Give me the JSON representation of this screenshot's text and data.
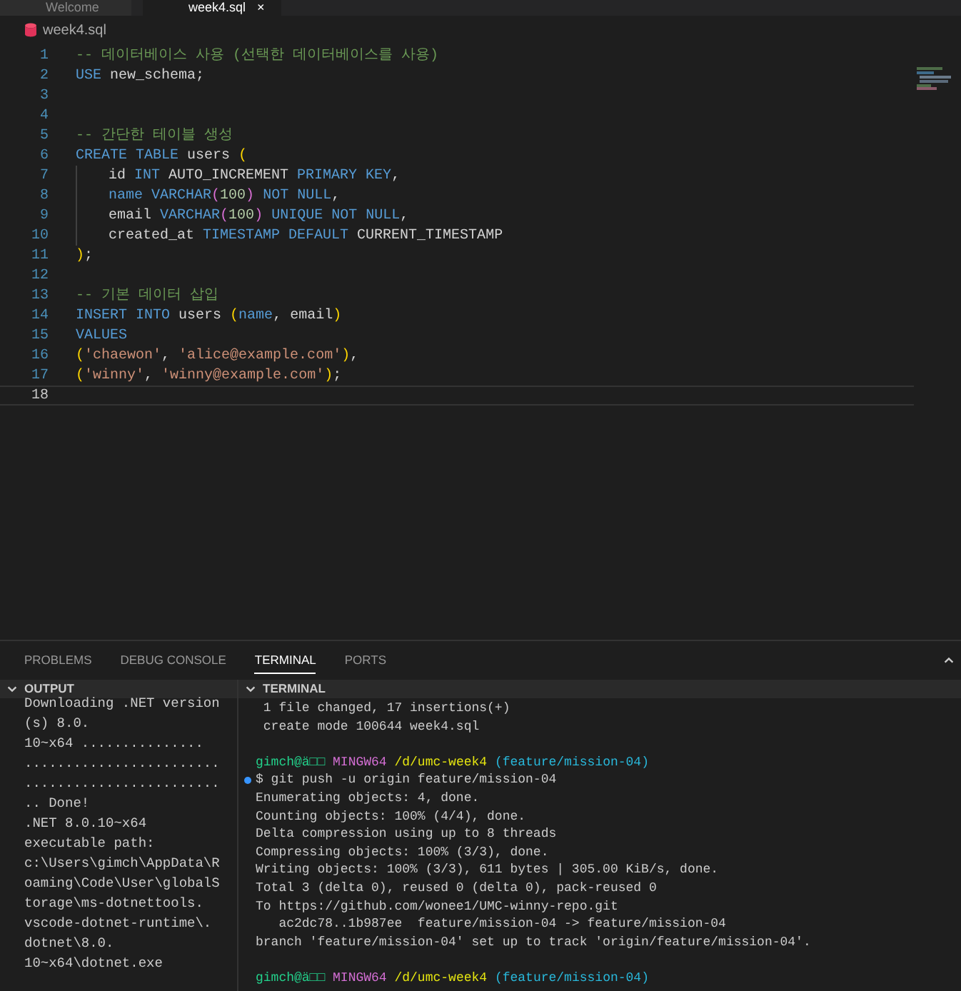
{
  "tabs": [
    {
      "label": "Welcome",
      "selected": false,
      "closable": false
    },
    {
      "label": "week4.sql",
      "selected": true,
      "closable": true
    }
  ],
  "tab_close": "×",
  "breadcrumb": "week4.sql",
  "editor": {
    "lines": [
      {
        "number": "1",
        "active": false,
        "tokens": [
          {
            "kind": "comment",
            "text": "-- 데이터베이스 사용 (선택한 데이터베이스를 사용)"
          }
        ]
      },
      {
        "number": "2",
        "active": false,
        "tokens": [
          {
            "kind": "keyword",
            "text": "USE"
          },
          {
            "kind": "plain",
            "text": " new_schema;"
          }
        ]
      },
      {
        "number": "3",
        "active": false
      },
      {
        "number": "4",
        "active": false
      },
      {
        "number": "5",
        "active": false,
        "tokens": [
          {
            "kind": "comment",
            "text": "-- 간단한 테이블 생성"
          }
        ]
      },
      {
        "number": "6",
        "active": false,
        "tokens": [
          {
            "kind": "keyword",
            "text": "CREATE TABLE"
          },
          {
            "kind": "plain",
            "text": " users "
          },
          {
            "kind": "paren",
            "text": "("
          }
        ]
      },
      {
        "number": "7",
        "active": false,
        "indent": true,
        "tokens": [
          {
            "kind": "plain",
            "text": "id "
          },
          {
            "kind": "keyword",
            "text": "INT"
          },
          {
            "kind": "plain",
            "text": " AUTO_INCREMENT "
          },
          {
            "kind": "keyword",
            "text": "PRIMARY KEY"
          },
          {
            "kind": "plain",
            "text": ","
          }
        ]
      },
      {
        "number": "8",
        "active": false,
        "indent": true,
        "tokens": [
          {
            "kind": "keyword",
            "text": "name VARCHAR"
          },
          {
            "kind": "paren2",
            "text": "("
          },
          {
            "kind": "number",
            "text": "100"
          },
          {
            "kind": "paren2",
            "text": ")"
          },
          {
            "kind": "keyword",
            "text": " NOT NULL"
          },
          {
            "kind": "plain",
            "text": ","
          }
        ]
      },
      {
        "number": "9",
        "active": false,
        "indent": true,
        "tokens": [
          {
            "kind": "plain",
            "text": "email "
          },
          {
            "kind": "keyword",
            "text": "VARCHAR"
          },
          {
            "kind": "paren2",
            "text": "("
          },
          {
            "kind": "number",
            "text": "100"
          },
          {
            "kind": "paren2",
            "text": ")"
          },
          {
            "kind": "keyword",
            "text": " UNIQUE NOT NULL"
          },
          {
            "kind": "plain",
            "text": ","
          }
        ]
      },
      {
        "number": "10",
        "active": false,
        "indent": true,
        "tokens": [
          {
            "kind": "plain",
            "text": "created_at "
          },
          {
            "kind": "keyword",
            "text": "TIMESTAMP DEFAULT"
          },
          {
            "kind": "plain",
            "text": " CURRENT_TIMESTAMP"
          }
        ]
      },
      {
        "number": "11",
        "active": false,
        "tokens": [
          {
            "kind": "paren",
            "text": ")"
          },
          {
            "kind": "plain",
            "text": ";"
          }
        ]
      },
      {
        "number": "12",
        "active": false
      },
      {
        "number": "13",
        "active": false,
        "tokens": [
          {
            "kind": "comment",
            "text": "-- 기본 데이터 삽입"
          }
        ]
      },
      {
        "number": "14",
        "active": false,
        "tokens": [
          {
            "kind": "keyword",
            "text": "INSERT INTO"
          },
          {
            "kind": "plain",
            "text": " users "
          },
          {
            "kind": "paren",
            "text": "("
          },
          {
            "kind": "keyword",
            "text": "name"
          },
          {
            "kind": "plain",
            "text": ", email"
          },
          {
            "kind": "paren",
            "text": ")"
          }
        ]
      },
      {
        "number": "15",
        "active": false,
        "tokens": [
          {
            "kind": "keyword",
            "text": "VALUES"
          }
        ]
      },
      {
        "number": "16",
        "active": false,
        "tokens": [
          {
            "kind": "paren",
            "text": "("
          },
          {
            "kind": "string",
            "text": "'chaewon'"
          },
          {
            "kind": "plain",
            "text": ", "
          },
          {
            "kind": "string",
            "text": "'alice@example.com'"
          },
          {
            "kind": "paren",
            "text": ")"
          },
          {
            "kind": "plain",
            "text": ","
          }
        ]
      },
      {
        "number": "17",
        "active": false,
        "tokens": [
          {
            "kind": "paren",
            "text": "("
          },
          {
            "kind": "string",
            "text": "'winny'"
          },
          {
            "kind": "plain",
            "text": ", "
          },
          {
            "kind": "string",
            "text": "'winny@example.com'"
          },
          {
            "kind": "paren",
            "text": ")"
          },
          {
            "kind": "plain",
            "text": ";"
          }
        ]
      },
      {
        "number": "18",
        "active": true
      }
    ]
  },
  "panel_tabs": [
    {
      "label": "PROBLEMS",
      "selected": false
    },
    {
      "label": "DEBUG CONSOLE",
      "selected": false
    },
    {
      "label": "TERMINAL",
      "selected": true
    },
    {
      "label": "PORTS",
      "selected": false
    }
  ],
  "output": {
    "title": "OUTPUT",
    "lines": [
      "Downloading .NET version",
      "(s) 8.0.",
      "10~x64 ...............",
      "........................",
      "........................",
      ".. Done!",
      ".NET 8.0.10~x64",
      "executable path:",
      "c:\\Users\\gimch\\AppData\\R",
      "oaming\\Code\\User\\globalS",
      "torage\\ms-dotnettools.",
      "vscode-dotnet-runtime\\.",
      "dotnet\\8.0.",
      "10~x64\\dotnet.exe"
    ]
  },
  "terminal": {
    "title": "TERMINAL",
    "lines": [
      {
        "kind": "text",
        "text": " 1 file changed, 17 insertions(+)"
      },
      {
        "kind": "text",
        "text": " create mode 100644 week4.sql"
      },
      {
        "kind": "blank"
      },
      {
        "kind": "prompt",
        "user": "gimch@ä□□",
        "host": "MINGW64",
        "path": "/d/umc-week4",
        "branch": "(feature/mission-04)"
      },
      {
        "kind": "command",
        "text": "$ git push -u origin feature/mission-04"
      },
      {
        "kind": "text",
        "text": "Enumerating objects: 4, done."
      },
      {
        "kind": "text",
        "text": "Counting objects: 100% (4/4), done."
      },
      {
        "kind": "text",
        "text": "Delta compression using up to 8 threads"
      },
      {
        "kind": "text",
        "text": "Compressing objects: 100% (3/3), done."
      },
      {
        "kind": "text",
        "text": "Writing objects: 100% (3/3), 611 bytes | 305.00 KiB/s, done."
      },
      {
        "kind": "text",
        "text": "Total 3 (delta 0), reused 0 (delta 0), pack-reused 0"
      },
      {
        "kind": "text",
        "text": "To https://github.com/wonee1/UMC-winny-repo.git"
      },
      {
        "kind": "text",
        "text": "   ac2dc78..1b987ee  feature/mission-04 -> feature/mission-04"
      },
      {
        "kind": "text",
        "text": "branch 'feature/mission-04' set up to track 'origin/feature/mission-04'."
      },
      {
        "kind": "blank"
      },
      {
        "kind": "prompt",
        "user": "gimch@ä□□",
        "host": "MINGW64",
        "path": "/d/umc-week4",
        "branch": "(feature/mission-04)"
      }
    ]
  }
}
